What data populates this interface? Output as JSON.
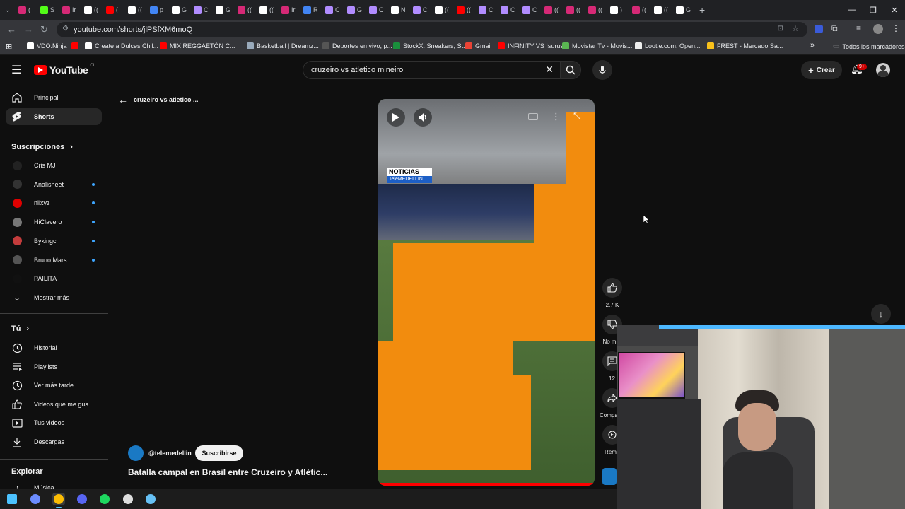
{
  "browser": {
    "tabs": [
      {
        "icon": "instagram-icon",
        "label": "(",
        "color": "#d62976"
      },
      {
        "icon": "kick-icon",
        "label": "S",
        "color": "#53fc18"
      },
      {
        "icon": "instagram-icon",
        "label": "Ir",
        "color": "#d62976"
      },
      {
        "icon": "tiktok-icon",
        "label": "((",
        "color": "#ffffff"
      },
      {
        "icon": "youtube-icon",
        "label": "(",
        "color": "#ff0000"
      },
      {
        "icon": "tiktok-icon",
        "label": "((",
        "color": "#ffffff"
      },
      {
        "icon": "generic-icon",
        "label": "p",
        "color": "#4285f4"
      },
      {
        "icon": "x-icon",
        "label": "G",
        "color": "#ffffff"
      },
      {
        "icon": "pen-icon",
        "label": "C",
        "color": "#b18cff"
      },
      {
        "icon": "x-icon",
        "label": "G",
        "color": "#ffffff"
      },
      {
        "icon": "instagram-icon",
        "label": "((",
        "color": "#d62976"
      },
      {
        "icon": "tiktok-icon",
        "label": "((",
        "color": "#ffffff"
      },
      {
        "icon": "instagram-icon",
        "label": "Ir",
        "color": "#d62976"
      },
      {
        "icon": "generic-icon",
        "label": "R",
        "color": "#4285f4"
      },
      {
        "icon": "pen-icon",
        "label": "C",
        "color": "#b18cff"
      },
      {
        "icon": "pen-icon",
        "label": "G",
        "color": "#b18cff"
      },
      {
        "icon": "pen-icon",
        "label": "C",
        "color": "#b18cff"
      },
      {
        "icon": "tiktok-icon",
        "label": "N",
        "color": "#ffffff"
      },
      {
        "icon": "pen-icon",
        "label": "C",
        "color": "#b18cff"
      },
      {
        "icon": "tiktok-icon",
        "label": "((",
        "color": "#ffffff"
      },
      {
        "icon": "youtube-icon",
        "label": "((",
        "color": "#ff0000"
      },
      {
        "icon": "pen-icon",
        "label": "C",
        "color": "#b18cff"
      },
      {
        "icon": "pen-icon",
        "label": "C",
        "color": "#b18cff"
      },
      {
        "icon": "pen-icon",
        "label": "C",
        "color": "#b18cff"
      },
      {
        "icon": "instagram-icon",
        "label": "((",
        "color": "#d62976"
      },
      {
        "icon": "instagram-icon",
        "label": "((",
        "color": "#d62976"
      },
      {
        "icon": "instagram-icon",
        "label": "((",
        "color": "#d62976"
      },
      {
        "icon": "x-icon",
        "label": ")",
        "color": "#ffffff"
      },
      {
        "icon": "instagram-icon",
        "label": "((",
        "color": "#d62976"
      },
      {
        "icon": "tiktok-icon",
        "label": "((",
        "color": "#ffffff"
      },
      {
        "icon": "x-icon",
        "label": "G",
        "color": "#ffffff"
      }
    ],
    "url": "youtube.com/shorts/jlPSfXM6moQ",
    "bookmarks": [
      {
        "label": "VDO.Ninja",
        "color": "#ffffff"
      },
      {
        "label": "",
        "color": "#ff0000"
      },
      {
        "label": "Create a Dulces Chil...",
        "color": "#ffffff"
      },
      {
        "label": "MIX REGGAETÓN C...",
        "color": "#ff0000"
      },
      {
        "label": "Basketball | Dreamz...",
        "color": "#9ab"
      },
      {
        "label": "Deportes en vivo, p...",
        "color": "#555"
      },
      {
        "label": "StockX: Sneakers, St...",
        "color": "#1a8f3c"
      },
      {
        "label": "Gmail",
        "color": "#ea4335"
      },
      {
        "label": "INFINITY VS Isurus",
        "color": "#ff0000"
      },
      {
        "label": "Movistar Tv - Movis...",
        "color": "#5ab552"
      },
      {
        "label": "Lootie.com: Open...",
        "color": "#eee"
      },
      {
        "label": "FREST - Mercado Sa...",
        "color": "#f9c11b"
      }
    ],
    "all_bookmarks_label": "Todos los marcadores"
  },
  "youtube": {
    "logo_text": "YouTube",
    "country": "CL",
    "search_value": "cruzeiro vs atletico mineiro",
    "create_label": "Crear",
    "notifications_badge": "9+",
    "sidebar": {
      "main_items": [
        {
          "label": "Principal",
          "icon": "home-icon"
        },
        {
          "label": "Shorts",
          "icon": "shorts-icon"
        }
      ],
      "subscriptions_heading": "Suscripciones",
      "subscriptions": [
        {
          "label": "Cris MJ",
          "color": "#222222",
          "live": false
        },
        {
          "label": "Analisheet",
          "color": "#333333",
          "live": true
        },
        {
          "label": "nilxyz",
          "color": "#e00000",
          "live": true
        },
        {
          "label": "HiClavero",
          "color": "#777777",
          "live": true
        },
        {
          "label": "Bykingcl",
          "color": "#c33c3c",
          "live": true
        },
        {
          "label": "Bruno Mars",
          "color": "#555555",
          "live": true
        },
        {
          "label": "PAILITA",
          "color": "#111111",
          "live": false
        }
      ],
      "show_more_label": "Mostrar más",
      "you_heading": "Tú",
      "you_items": [
        {
          "label": "Historial",
          "icon": "history-icon"
        },
        {
          "label": "Playlists",
          "icon": "playlists-icon"
        },
        {
          "label": "Ver más tarde",
          "icon": "watch-later-icon"
        },
        {
          "label": "Videos que me gus...",
          "icon": "like-icon"
        },
        {
          "label": "Tus videos",
          "icon": "your-videos-icon"
        },
        {
          "label": "Descargas",
          "icon": "download-icon"
        }
      ],
      "explore_heading": "Explorar",
      "explore_items": [
        {
          "label": "Música",
          "icon": "music-icon"
        }
      ]
    },
    "back_title": "cruzeiro vs atletico ...",
    "video": {
      "overlay_top": "NOTICIAS",
      "overlay_bottom": "TeleMEDELLIN"
    },
    "channel": {
      "handle": "@telemedellin",
      "subscribe_label": "Suscribirse"
    },
    "video_title": "Batalla campal en Brasil entre Cruzeiro y Atlétic...",
    "actions": {
      "likes": "2.7 K",
      "dislike": "No m",
      "comments": "12",
      "share": "Compa",
      "remix": "Rem"
    }
  },
  "taskbar": {
    "apps": [
      {
        "icon": "windows-icon",
        "color": "#4cc2ff"
      },
      {
        "icon": "copilot-icon",
        "color": "#6b8cff"
      },
      {
        "icon": "chrome-icon",
        "color": "#fbbc04"
      },
      {
        "icon": "discord-icon",
        "color": "#5865f2"
      },
      {
        "icon": "spotify-icon",
        "color": "#1ed760"
      },
      {
        "icon": "obs-icon",
        "color": "#dddddd"
      },
      {
        "icon": "steam-icon",
        "color": "#66c0f4"
      }
    ]
  }
}
